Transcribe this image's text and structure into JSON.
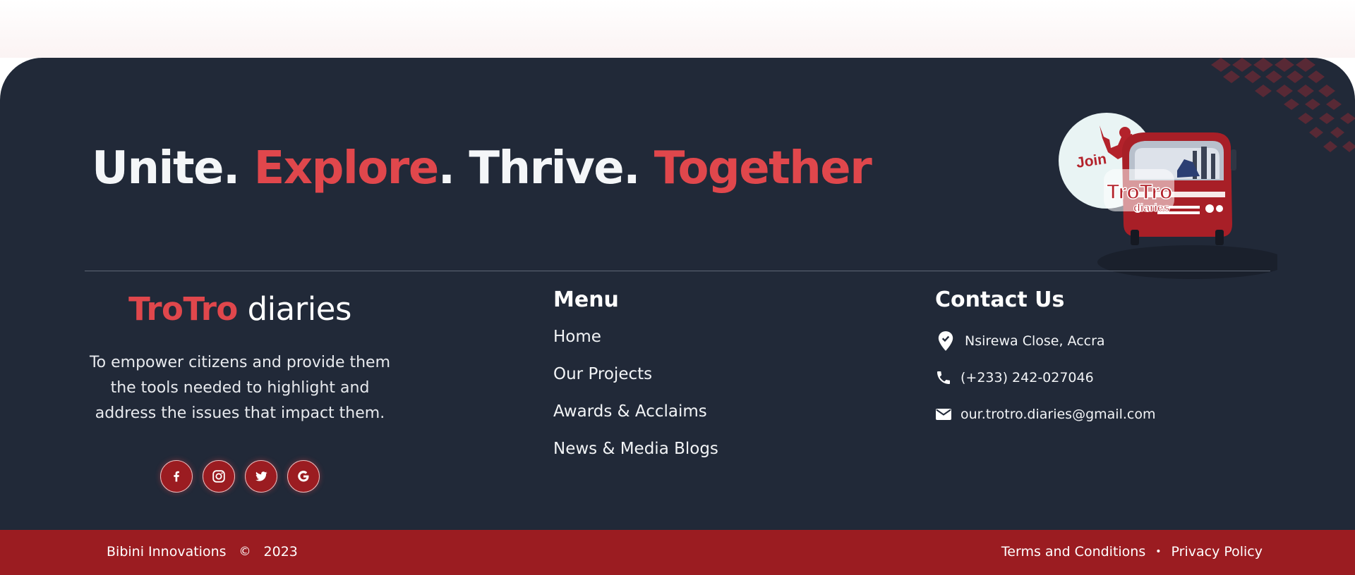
{
  "tagline": {
    "part1": "Unite. ",
    "part2": "Explore",
    "part3": ". Thrive. ",
    "part4": "Together"
  },
  "join_logo": {
    "bubble_text": "Join",
    "brand_text": "TroTro",
    "brand_sub": "diaries"
  },
  "brand": {
    "name_accent": "TroTro",
    "name_rest": " diaries",
    "mission": "To empower citizens and provide them the tools needed to highlight and address the issues that impact them."
  },
  "socials": [
    {
      "name": "facebook",
      "icon": "facebook-icon"
    },
    {
      "name": "instagram",
      "icon": "instagram-icon"
    },
    {
      "name": "twitter",
      "icon": "twitter-icon"
    },
    {
      "name": "google",
      "icon": "google-icon"
    }
  ],
  "menu": {
    "title": "Menu",
    "items": [
      "Home",
      "Our Projects",
      "Awards & Acclaims",
      "News & Media Blogs"
    ]
  },
  "contact": {
    "title": "Contact Us",
    "address": "Nsirewa Close, Accra",
    "phone": "(+233) 242-027046",
    "email": "our.trotro.diaries@gmail.com"
  },
  "bottom": {
    "company": "Bibini Innovations",
    "copyright_symbol": "©",
    "year": "2023",
    "terms": "Terms and Conditions",
    "separator": "•",
    "privacy": "Privacy Policy"
  },
  "colors": {
    "footer_bg": "#212938",
    "accent_red": "#e0474c",
    "bottom_bar": "#9b1c21"
  }
}
